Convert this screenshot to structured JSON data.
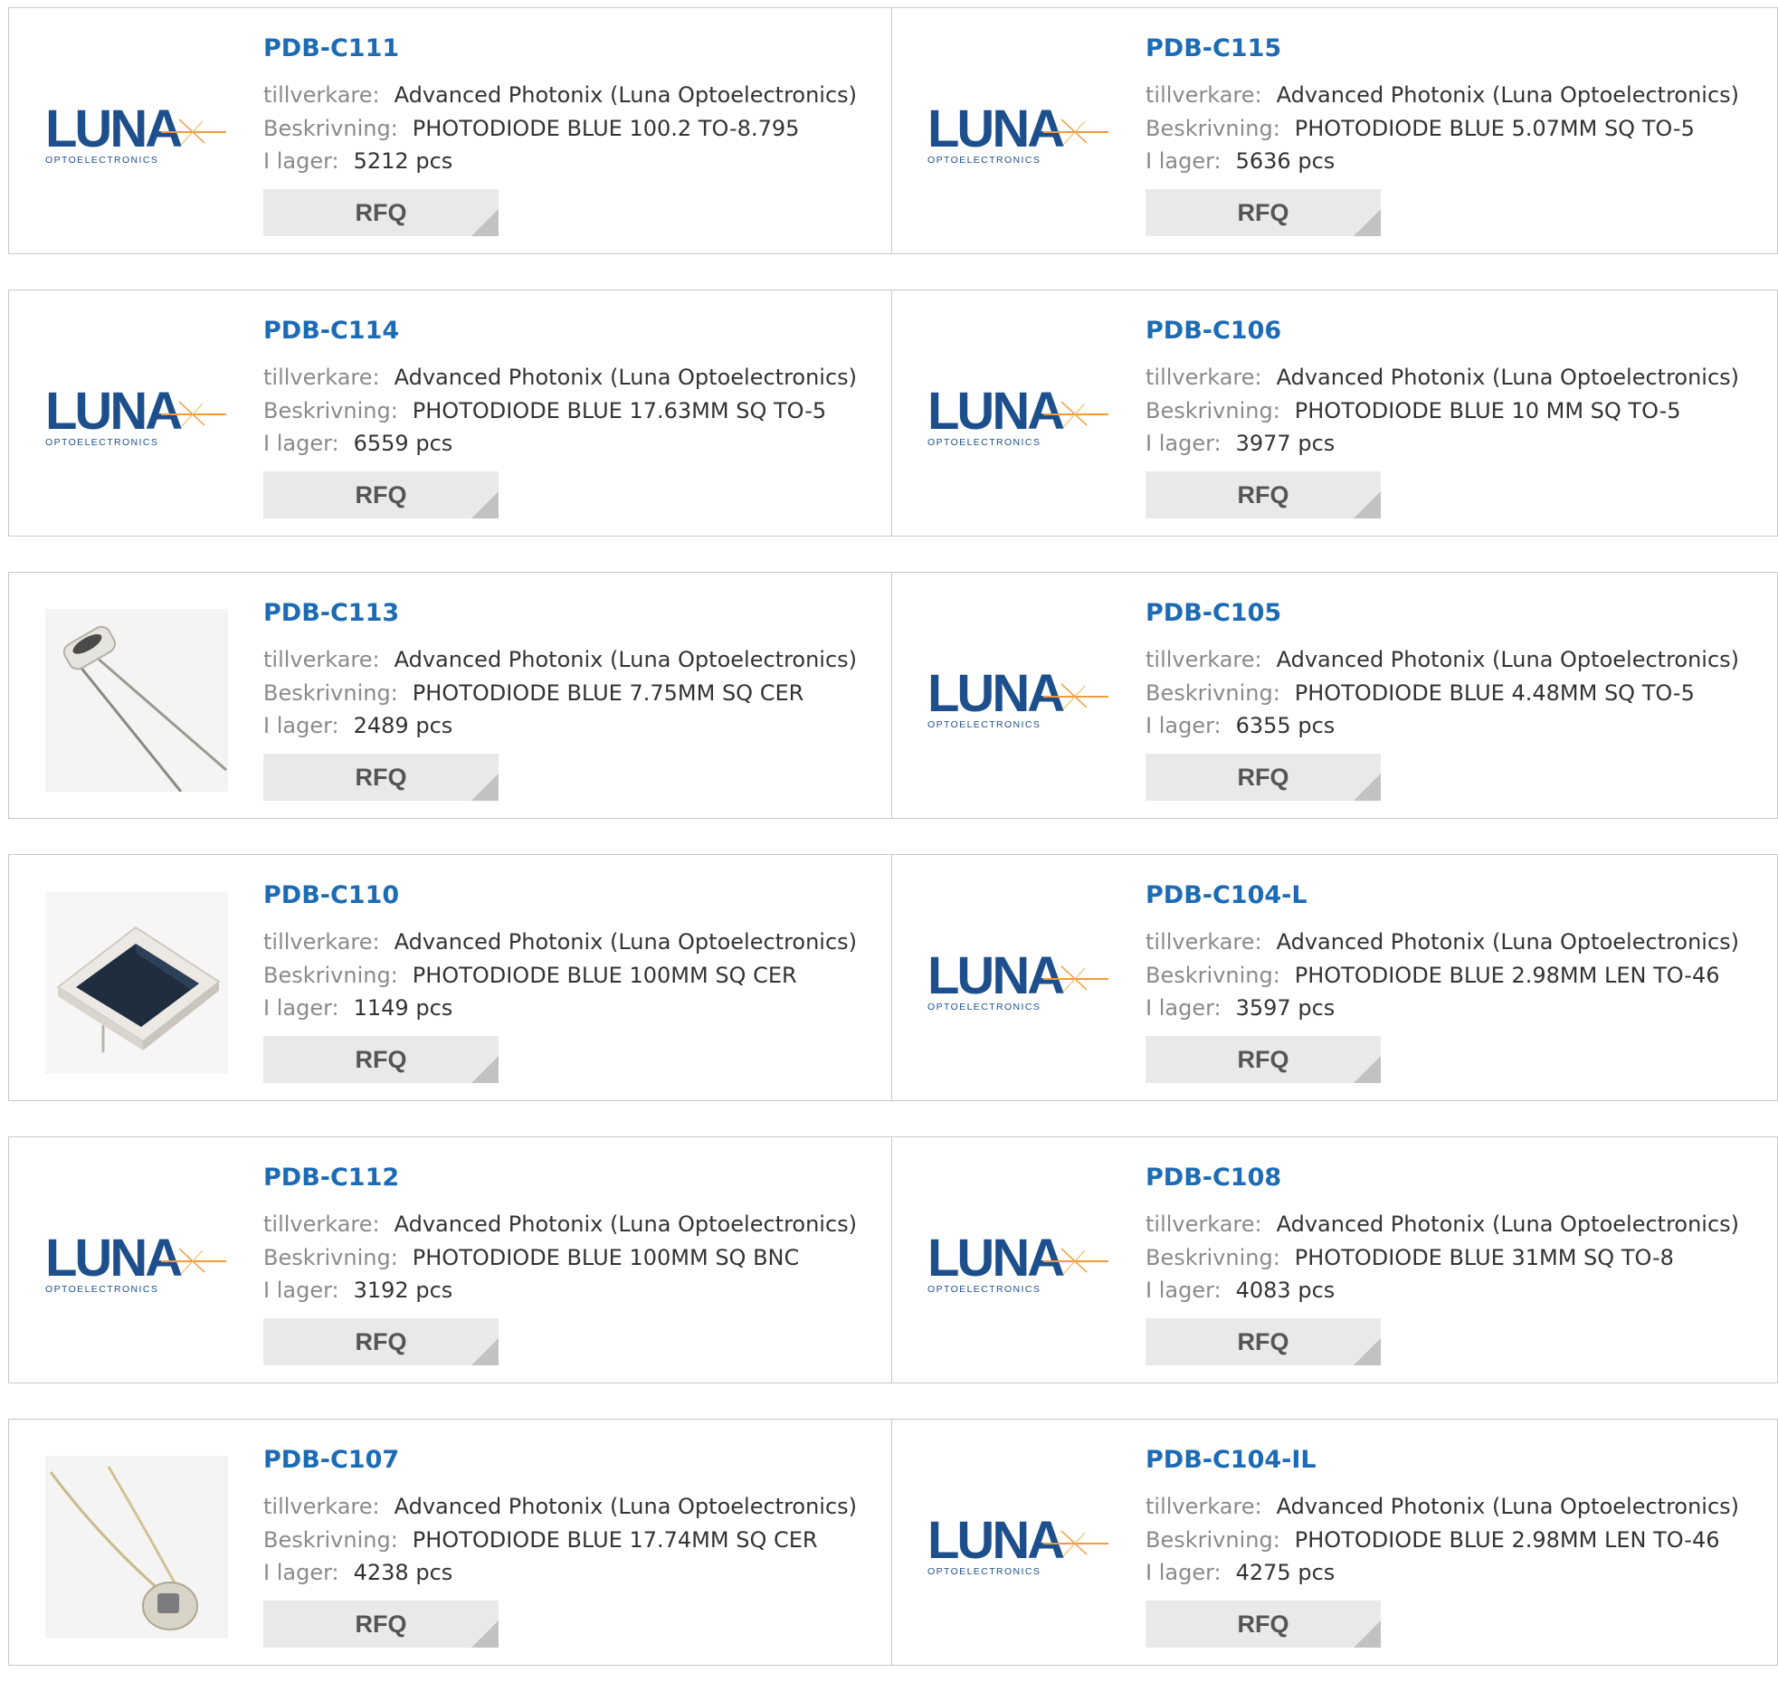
{
  "labels": {
    "manufacturer": "tillverkare:",
    "description": "Beskrivning:",
    "stock": "I lager:",
    "rfq": "RFQ"
  },
  "logo": {
    "word": "LUNA",
    "sub": "OPTOELECTRONICS"
  },
  "colors": {
    "accent": "#1c6bb4",
    "logo_blue": "#1d4f8c",
    "logo_orange": "#f39a3a"
  },
  "products": [
    {
      "part": "PDB-C111",
      "manufacturer": "Advanced Photonix (Luna Optoelectronics)",
      "description": "PHOTODIODE BLUE 100.2 TO-8.795",
      "stock": "5212 pcs",
      "image": "luna-logo"
    },
    {
      "part": "PDB-C115",
      "manufacturer": "Advanced Photonix (Luna Optoelectronics)",
      "description": "PHOTODIODE BLUE 5.07MM SQ TO-5",
      "stock": "5636 pcs",
      "image": "luna-logo"
    },
    {
      "part": "PDB-C114",
      "manufacturer": "Advanced Photonix (Luna Optoelectronics)",
      "description": "PHOTODIODE BLUE 17.63MM SQ TO-5",
      "stock": "6559 pcs",
      "image": "luna-logo"
    },
    {
      "part": "PDB-C106",
      "manufacturer": "Advanced Photonix (Luna Optoelectronics)",
      "description": "PHOTODIODE BLUE 10 MM SQ TO-5",
      "stock": "3977 pcs",
      "image": "luna-logo"
    },
    {
      "part": "PDB-C113",
      "manufacturer": "Advanced Photonix (Luna Optoelectronics)",
      "description": "PHOTODIODE BLUE 7.75MM SQ CER",
      "stock": "2489 pcs",
      "image": "photodiode-leaded-left"
    },
    {
      "part": "PDB-C105",
      "manufacturer": "Advanced Photonix (Luna Optoelectronics)",
      "description": "PHOTODIODE BLUE 4.48MM SQ TO-5",
      "stock": "6355 pcs",
      "image": "luna-logo"
    },
    {
      "part": "PDB-C110",
      "manufacturer": "Advanced Photonix (Luna Optoelectronics)",
      "description": "PHOTODIODE BLUE 100MM SQ CER",
      "stock": "1149 pcs",
      "image": "photodiode-ceramic-square"
    },
    {
      "part": "PDB-C104-L",
      "manufacturer": "Advanced Photonix (Luna Optoelectronics)",
      "description": "PHOTODIODE BLUE 2.98MM LEN TO-46",
      "stock": "3597 pcs",
      "image": "luna-logo"
    },
    {
      "part": "PDB-C112",
      "manufacturer": "Advanced Photonix (Luna Optoelectronics)",
      "description": "PHOTODIODE BLUE 100MM SQ BNC",
      "stock": "3192 pcs",
      "image": "luna-logo"
    },
    {
      "part": "PDB-C108",
      "manufacturer": "Advanced Photonix (Luna Optoelectronics)",
      "description": "PHOTODIODE BLUE 31MM SQ TO-8",
      "stock": "4083 pcs",
      "image": "luna-logo"
    },
    {
      "part": "PDB-C107",
      "manufacturer": "Advanced Photonix (Luna Optoelectronics)",
      "description": "PHOTODIODE BLUE 17.74MM SQ CER",
      "stock": "4238 pcs",
      "image": "photodiode-leaded-round"
    },
    {
      "part": "PDB-C104-IL",
      "manufacturer": "Advanced Photonix (Luna Optoelectronics)",
      "description": "PHOTODIODE BLUE 2.98MM LEN TO-46",
      "stock": "4275 pcs",
      "image": "luna-logo"
    }
  ]
}
